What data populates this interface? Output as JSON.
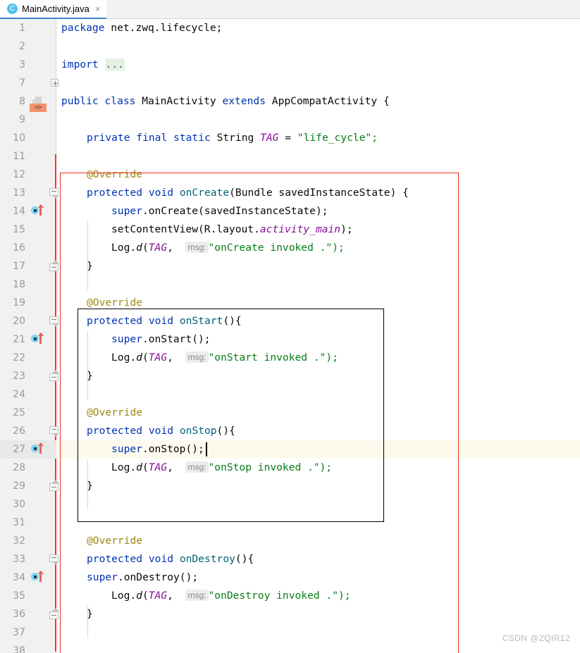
{
  "tab": {
    "icon": "java-class-icon",
    "label": "MainActivity.java",
    "close": "×"
  },
  "editor": {
    "language": "java",
    "caret_line": 27,
    "colors": {
      "keyword": "#0033B3",
      "string": "#067D17",
      "annotation": "#9E880D",
      "field": "#871094",
      "method": "#00627A",
      "text": "#080808",
      "gutter_bg": "#F1F1F1",
      "line_number": "#999999",
      "caret_line_bg": "#FCFAED",
      "change_stripe": "#E8382C"
    },
    "lines": [
      {
        "n": "1",
        "code": "package net.zwq.lifecycle;"
      },
      {
        "n": "2",
        "code": ""
      },
      {
        "n": "3",
        "code": "import ..."
      },
      {
        "n": "7",
        "code": ""
      },
      {
        "n": "8",
        "code": "public class MainActivity extends AppCompatActivity {"
      },
      {
        "n": "9",
        "code": ""
      },
      {
        "n": "10",
        "code": "    private final static String TAG = \"life_cycle\";"
      },
      {
        "n": "11",
        "code": ""
      },
      {
        "n": "12",
        "code": "    @Override"
      },
      {
        "n": "13",
        "code": "    protected void onCreate(Bundle savedInstanceState) {"
      },
      {
        "n": "14",
        "code": "        super.onCreate(savedInstanceState);"
      },
      {
        "n": "15",
        "code": "        setContentView(R.layout.activity_main);"
      },
      {
        "n": "16",
        "code": "        Log.d(TAG,  msg: \"onCreate invoked .\");"
      },
      {
        "n": "17",
        "code": "    }"
      },
      {
        "n": "18",
        "code": ""
      },
      {
        "n": "19",
        "code": "    @Override"
      },
      {
        "n": "20",
        "code": "    protected void onStart(){"
      },
      {
        "n": "21",
        "code": "        super.onStart();"
      },
      {
        "n": "22",
        "code": "        Log.d(TAG,  msg: \"onStart invoked .\");"
      },
      {
        "n": "23",
        "code": "    }"
      },
      {
        "n": "24",
        "code": ""
      },
      {
        "n": "25",
        "code": "    @Override"
      },
      {
        "n": "26",
        "code": "    protected void onStop(){"
      },
      {
        "n": "27",
        "code": "        super.onStop();"
      },
      {
        "n": "28",
        "code": "        Log.d(TAG,  msg: \"onStop invoked .\");"
      },
      {
        "n": "29",
        "code": "    }"
      },
      {
        "n": "30",
        "code": ""
      },
      {
        "n": "31",
        "code": ""
      },
      {
        "n": "32",
        "code": "    @Override"
      },
      {
        "n": "33",
        "code": "    protected void onDestroy(){"
      },
      {
        "n": "34",
        "code": "    super.onDestroy();"
      },
      {
        "n": "35",
        "code": "        Log.d(TAG,  msg: \"onDestroy invoked .\");"
      },
      {
        "n": "36",
        "code": "    }"
      },
      {
        "n": "37",
        "code": ""
      },
      {
        "n": "38",
        "code": ""
      }
    ],
    "line_numbers": {
      "n1": "1",
      "n2": "2",
      "n3": "3",
      "n7": "7",
      "n8": "8",
      "n9": "9",
      "n10": "10",
      "n11": "11",
      "n12": "12",
      "n13": "13",
      "n14": "14",
      "n15": "15",
      "n16": "16",
      "n17": "17",
      "n18": "18",
      "n19": "19",
      "n20": "20",
      "n21": "21",
      "n22": "22",
      "n23": "23",
      "n24": "24",
      "n25": "25",
      "n26": "26",
      "n27": "27",
      "n28": "28",
      "n29": "29",
      "n30": "30",
      "n31": "31",
      "n32": "32",
      "n33": "33",
      "n34": "34",
      "n35": "35",
      "n36": "36",
      "n37": "37",
      "n38": "38"
    },
    "tokens": {
      "kw_package": "package",
      "pkg_name": " net.zwq.lifecycle;",
      "kw_import": "import",
      "import_folded": "...",
      "kw_public": "public",
      "kw_class": "class",
      "class_name": "MainActivity",
      "kw_extends": "extends",
      "super_class": "AppCompatActivity",
      "brace_open": "{",
      "brace_close": "}",
      "kw_private": "private",
      "kw_final": "final",
      "kw_static": "static",
      "type_string": "String",
      "field_tag": "TAG",
      "eq": "=",
      "tag_value": "\"life_cycle\";",
      "annotation_override": "@Override",
      "kw_protected": "protected",
      "kw_void": "void",
      "m_oncreate": "onCreate",
      "oncreate_params": "(Bundle savedInstanceState) {",
      "kw_super": "super",
      "super_oncreate": ".onCreate(savedInstanceState);",
      "setcontentview": "setContentView(R.layout.",
      "activity_main": "activity_main",
      "setcontentview_end": ");",
      "log": "Log.",
      "log_d": "d",
      "log_open": "(",
      "comma": ",",
      "hint_msg": "msg:",
      "str_oncreate": "\"onCreate invoked .\");",
      "m_onstart": "onStart",
      "empty_parens_brace": "(){",
      "super_onstart": ".onStart();",
      "str_onstart": "\"onStart invoked .\");",
      "m_onstop": "onStop",
      "super_onstop": ".onStop();",
      "str_onstop": "\"onStop invoked .\");",
      "m_ondestroy": "onDestroy",
      "super_ondestroy": ".onDestroy();",
      "str_ondestroy": "\"onDestroy invoked .\");"
    },
    "gutter_icons": {
      "layout_badge": "<>",
      "override_line_13": "overriding-method-icon",
      "override_line_20": "overriding-method-icon",
      "override_line_26": "overriding-method-icon",
      "override_line_33": "overriding-method-icon"
    }
  },
  "annotations": {
    "red_rect_color": "#EA3323",
    "black_rect_color": "#000000"
  },
  "watermark": "CSDN @ZQIR12"
}
